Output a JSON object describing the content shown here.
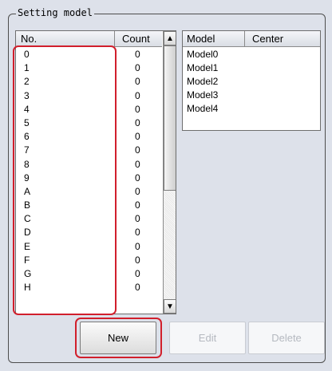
{
  "group": {
    "title": "Setting model"
  },
  "list": {
    "columns": {
      "no": "No.",
      "count": "Count"
    },
    "rows": [
      {
        "no": "0",
        "count": "0"
      },
      {
        "no": "1",
        "count": "0"
      },
      {
        "no": "2",
        "count": "0"
      },
      {
        "no": "3",
        "count": "0"
      },
      {
        "no": "4",
        "count": "0"
      },
      {
        "no": "5",
        "count": "0"
      },
      {
        "no": "6",
        "count": "0"
      },
      {
        "no": "7",
        "count": "0"
      },
      {
        "no": "8",
        "count": "0"
      },
      {
        "no": "9",
        "count": "0"
      },
      {
        "no": "A",
        "count": "0"
      },
      {
        "no": "B",
        "count": "0"
      },
      {
        "no": "C",
        "count": "0"
      },
      {
        "no": "D",
        "count": "0"
      },
      {
        "no": "E",
        "count": "0"
      },
      {
        "no": "F",
        "count": "0"
      },
      {
        "no": "G",
        "count": "0"
      },
      {
        "no": "H",
        "count": "0"
      }
    ],
    "scroll": {
      "up_icon": "▲",
      "down_icon": "▼"
    }
  },
  "models": {
    "columns": {
      "model": "Model",
      "center": "Center"
    },
    "rows": [
      "Model0",
      "Model1",
      "Model2",
      "Model3",
      "Model4"
    ]
  },
  "buttons": {
    "new": "New",
    "edit": "Edit",
    "delete": "Delete"
  },
  "colors": {
    "highlight": "#d11f2c",
    "panel": "#dde1ea"
  }
}
